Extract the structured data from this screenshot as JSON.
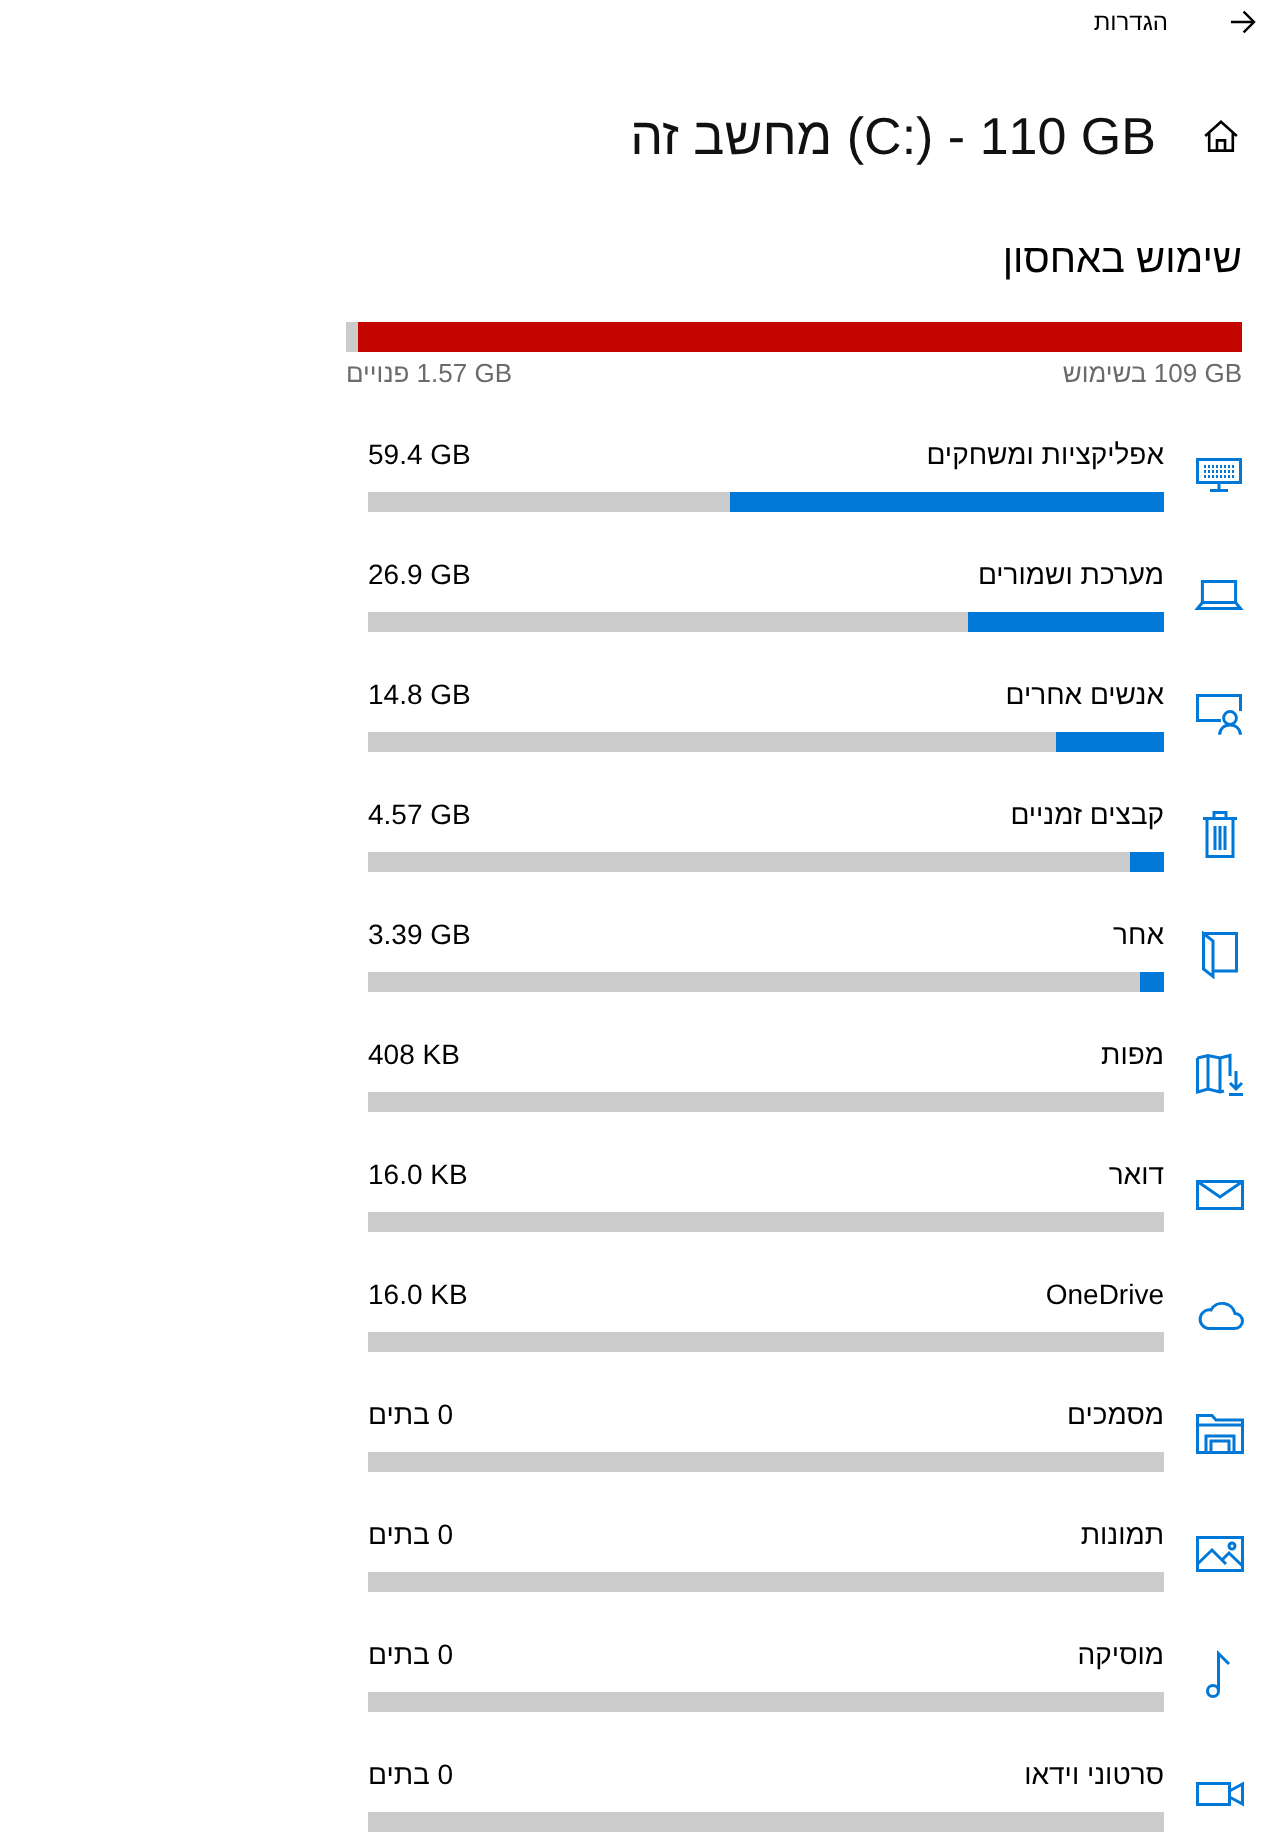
{
  "header": {
    "title": "הגדרות"
  },
  "drive": {
    "title": "מחשב זה (C:) - 110 GB"
  },
  "storage_usage": {
    "heading": "שימוש באחסון",
    "level": 0.986,
    "used": "109 GB בשימוש",
    "free": "1.57 GB פנויים"
  },
  "categories": [
    {
      "kind": "apps",
      "label": "אפליקציות ומשחקים",
      "size": "59.4 GB",
      "level": 0.545
    },
    {
      "kind": "system",
      "label": "מערכת ושמורים",
      "size": "26.9 GB",
      "level": 0.247
    },
    {
      "kind": "people",
      "label": "אנשים אחרים",
      "size": "14.8 GB",
      "level": 0.136
    },
    {
      "kind": "temp",
      "label": "קבצים זמניים",
      "size": "4.57 GB",
      "level": 0.042
    },
    {
      "kind": "other",
      "label": "אחר",
      "size": "3.39 GB",
      "level": 0.031
    },
    {
      "kind": "maps",
      "label": "מפות",
      "size": "408 KB"
    },
    {
      "kind": "mail",
      "label": "דואר",
      "size": "16.0 KB"
    },
    {
      "kind": "onedrive",
      "label": "OneDrive",
      "size": "16.0 KB"
    },
    {
      "kind": "documents",
      "label": "מסמכים",
      "size": "0 בתים"
    },
    {
      "kind": "pictures",
      "label": "תמונות",
      "size": "0 בתים"
    },
    {
      "kind": "music",
      "label": "מוסיקה",
      "size": "0 בתים"
    },
    {
      "kind": "videos",
      "label": "סרטוני וידאו",
      "size": "0 בתים"
    }
  ]
}
